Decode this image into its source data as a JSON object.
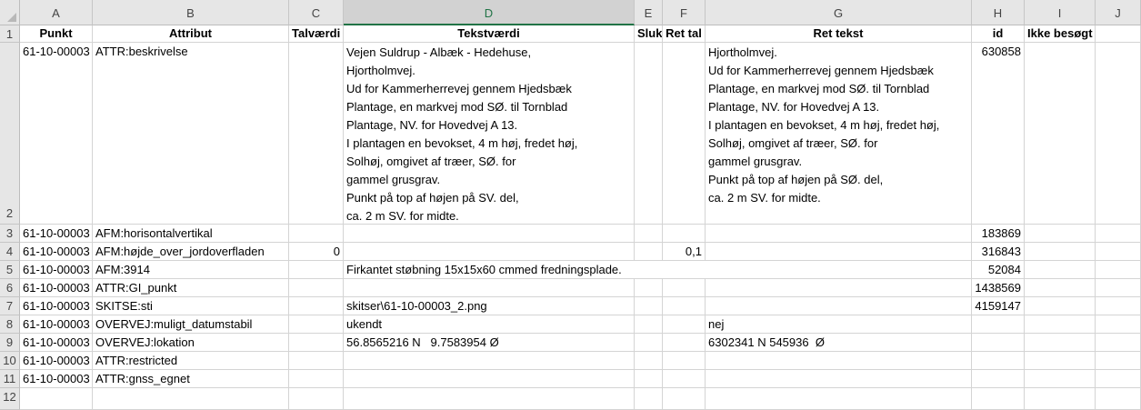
{
  "columns": [
    "A",
    "B",
    "C",
    "D",
    "E",
    "F",
    "G",
    "H",
    "I",
    "J"
  ],
  "rows": [
    "1",
    "2",
    "3",
    "4",
    "5",
    "6",
    "7",
    "8",
    "9",
    "10",
    "11",
    "12"
  ],
  "headers": {
    "A": "Punkt",
    "B": "Attribut",
    "C": "Talværdi",
    "D": "Tekstværdi",
    "E": "Sluk",
    "F": "Ret tal",
    "G": "Ret tekst",
    "H": "id",
    "I": "Ikke besøgt"
  },
  "data": {
    "r2": {
      "A": "61-10-00003",
      "B": "ATTR:beskrivelse",
      "D": "Vejen Suldrup - Albæk - Hedehuse,\nHjortholmvej.\nUd for Kammerherrevej gennem Hjedsbæk\nPlantage, en markvej mod SØ. til Tornblad\nPlantage, NV. for Hovedvej A 13.\nI plantagen en bevokset, 4 m høj, fredet høj,\nSolhøj, omgivet af træer, SØ. for\ngammel grusgrav.\nPunkt på top af højen på SV. del,\nca. 2 m SV. for midte.",
      "G": "Hjortholmvej.\nUd for Kammerherrevej gennem Hjedsbæk\nPlantage, en markvej mod SØ. til Tornblad\nPlantage, NV. for Hovedvej A 13.\nI plantagen en bevokset, 4 m høj, fredet høj,\nSolhøj, omgivet af træer, SØ. for\ngammel grusgrav.\nPunkt på top af højen på SØ. del,\nca. 2 m SV. for midte.",
      "H": "630858"
    },
    "r3": {
      "A": "61-10-00003",
      "B": "AFM:horisontalvertikal",
      "H": "183869"
    },
    "r4": {
      "A": "61-10-00003",
      "B": "AFM:højde_over_jordoverfladen",
      "C": "0",
      "F": "0,1",
      "H": "316843"
    },
    "r5": {
      "A": "61-10-00003",
      "B": "AFM:3914",
      "D": "Firkantet støbning 15x15x60 cmmed fredningsplade.",
      "H": "52084"
    },
    "r6": {
      "A": "61-10-00003",
      "B": "ATTR:GI_punkt",
      "H": "1438569"
    },
    "r7": {
      "A": "61-10-00003",
      "B": "SKITSE:sti",
      "D": "skitser\\61-10-00003_2.png",
      "H": "4159147"
    },
    "r8": {
      "A": "61-10-00003",
      "B": "OVERVEJ:muligt_datumstabil",
      "D": "ukendt",
      "G": "nej"
    },
    "r9": {
      "A": "61-10-00003",
      "B": "OVERVEJ:lokation",
      "D": "56.8565216 N   9.7583954 Ø",
      "G": "6302341 N 545936  Ø"
    },
    "r10": {
      "A": "61-10-00003",
      "B": "ATTR:restricted"
    },
    "r11": {
      "A": "61-10-00003",
      "B": "ATTR:gnss_egnet"
    }
  }
}
